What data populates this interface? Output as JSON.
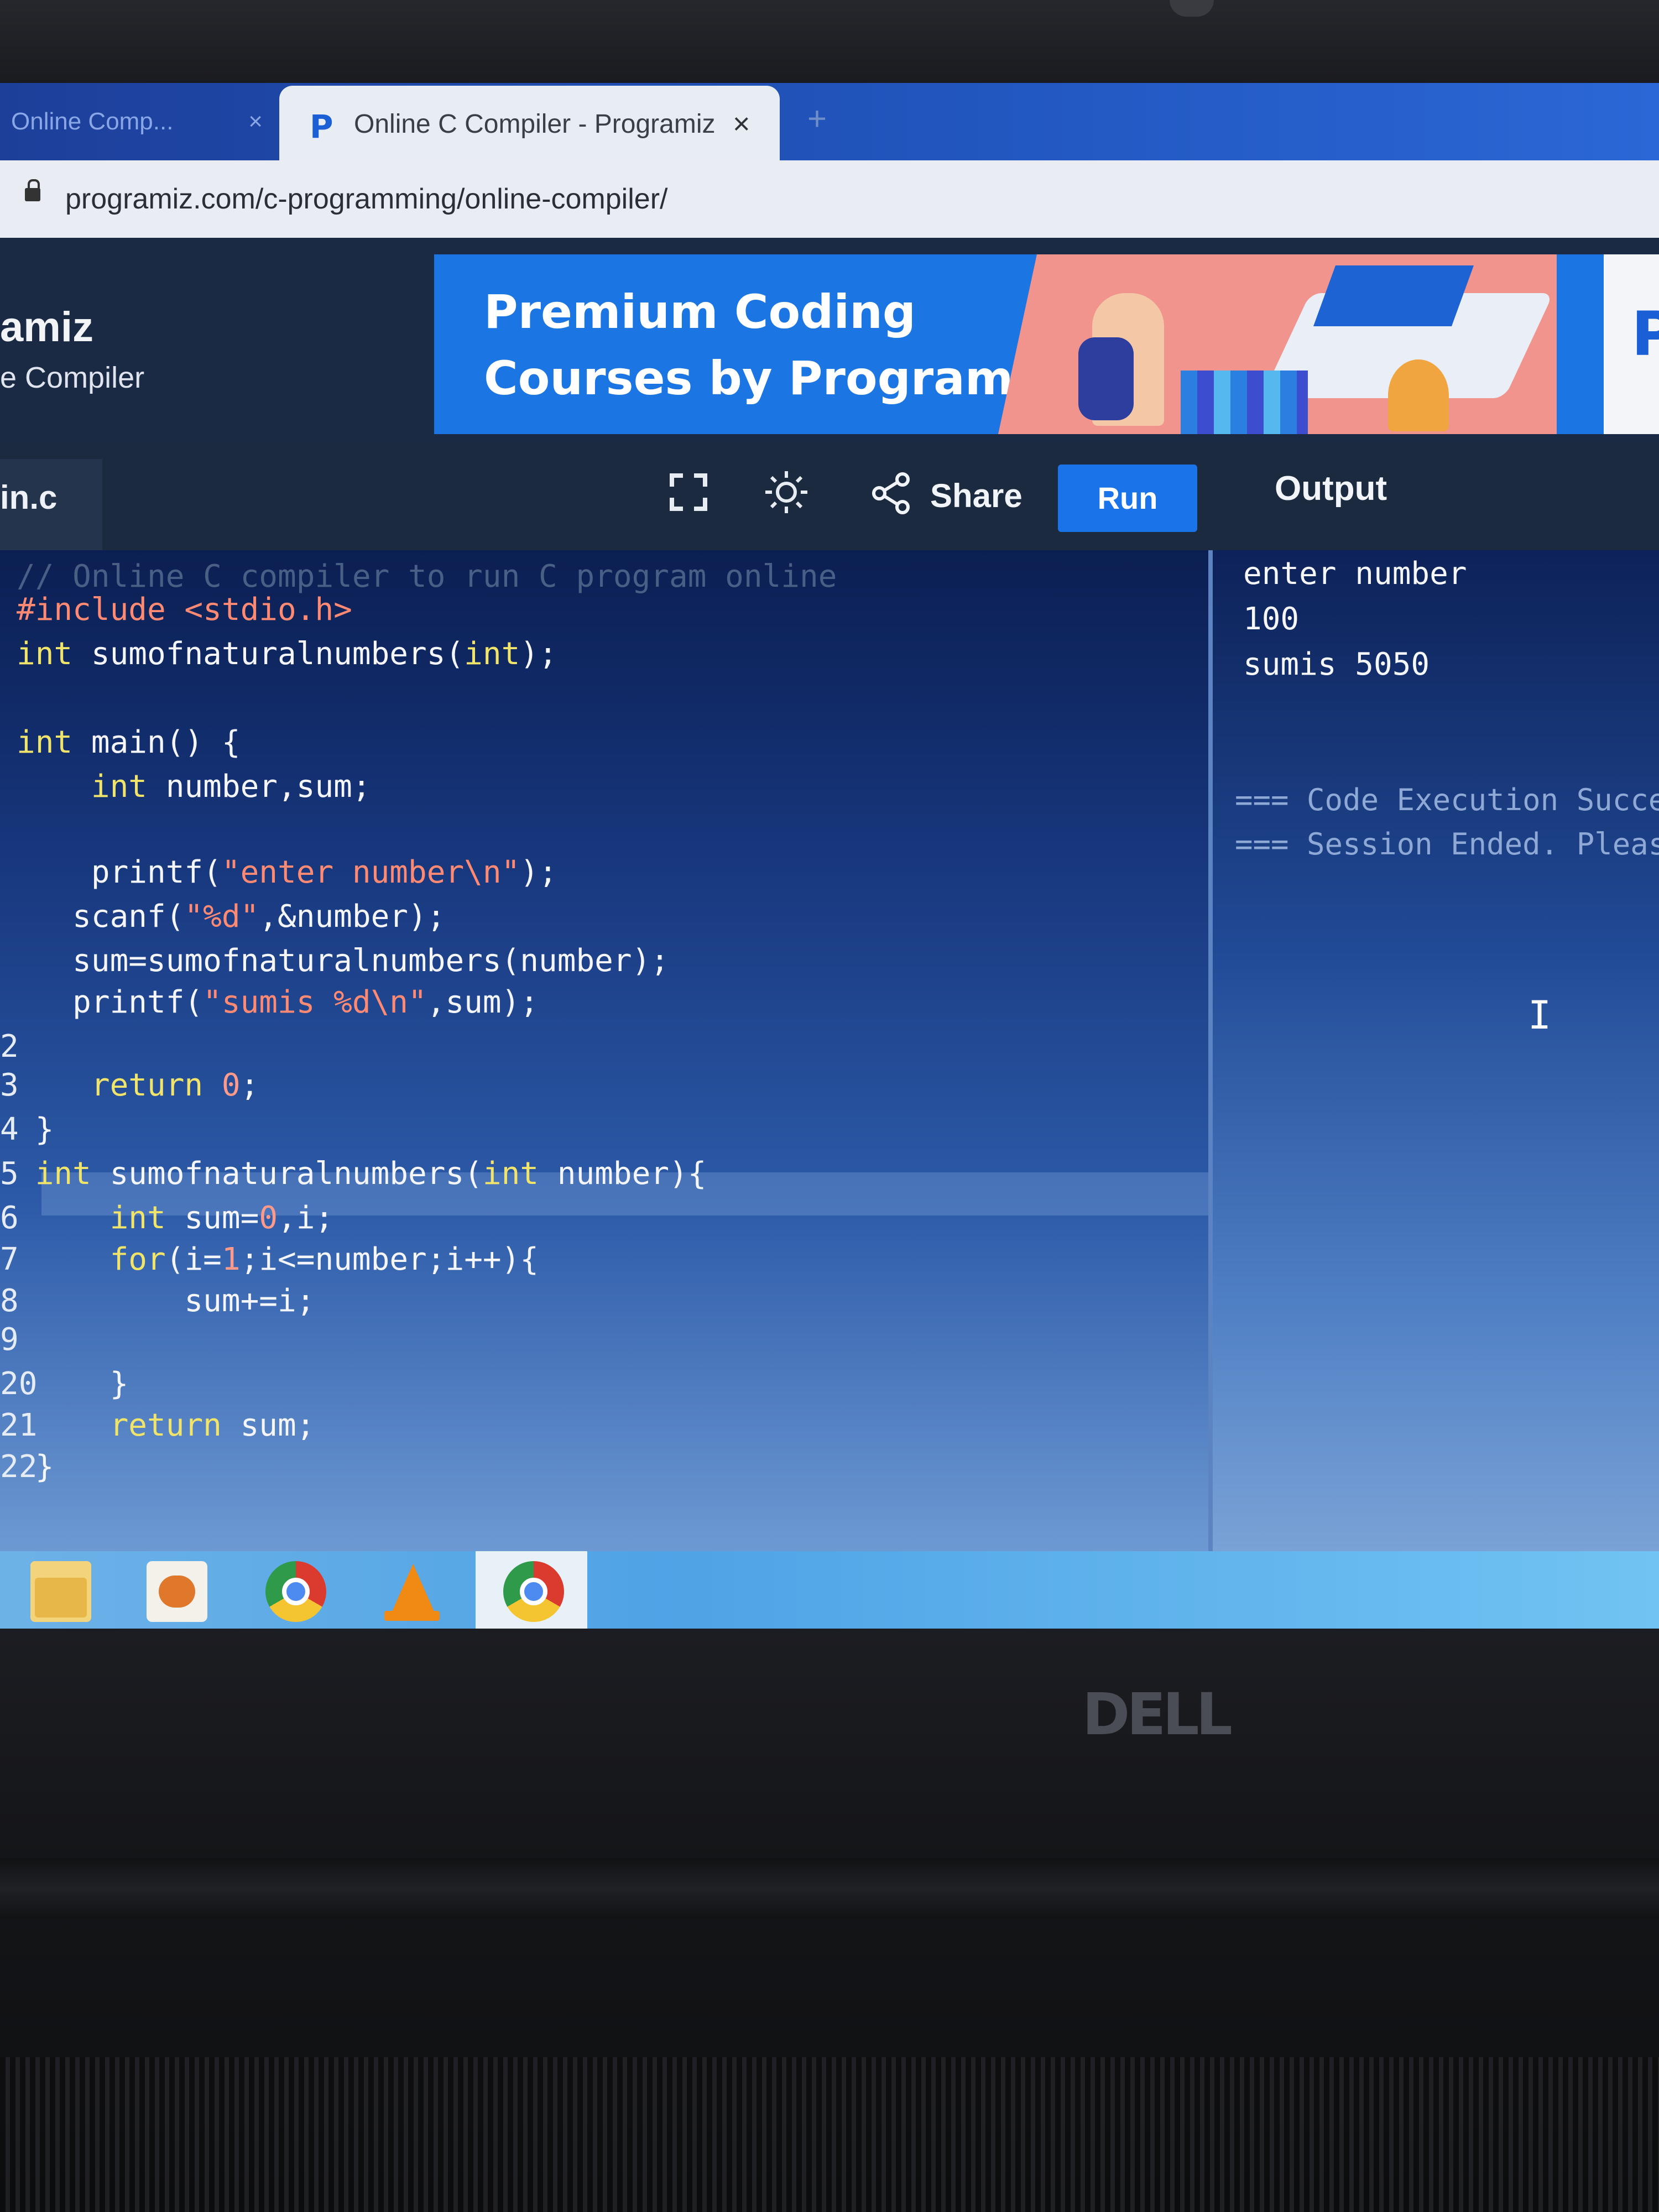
{
  "browser": {
    "inactive_tab_label": "Online Comp...",
    "inactive_tab_close": "×",
    "active_tab_favicon": "P",
    "active_tab_title": "Online C Compiler - Programiz",
    "active_tab_close": "×",
    "new_tab_symbol": "+",
    "url": "programiz.com/c-programming/online-compiler/"
  },
  "header": {
    "brand_name": "amiz",
    "brand_subtitle": "e Compiler",
    "banner_line1": "Premium Coding",
    "banner_line2": "Courses by Programiz",
    "banner_edge_glyph": "P"
  },
  "toolbar": {
    "file_tab": "in.c",
    "share_label": "Share",
    "run_label": "Run",
    "output_label": "Output",
    "expand_icon": "expand-icon",
    "theme_icon": "sun-icon",
    "share_icon": "share-icon"
  },
  "code_lines": [
    {
      "num": "",
      "text": "// Online C compiler to run C program online"
    },
    {
      "num": "",
      "text": "#include <stdio.h>"
    },
    {
      "num": "",
      "text": "int sumofnaturalnumbers(int);"
    },
    {
      "num": "",
      "text": ""
    },
    {
      "num": "",
      "text": "int main() {"
    },
    {
      "num": "",
      "text": "    int number,sum;"
    },
    {
      "num": "",
      "text": ""
    },
    {
      "num": "",
      "text": "    printf(\"enter number\\n\");"
    },
    {
      "num": "",
      "text": "   scanf(\"%d\",&number);"
    },
    {
      "num": "",
      "text": "   sum=sumofnaturalnumbers(number);"
    },
    {
      "num": "",
      "text": "   printf(\"sumis %d\\n\",sum);"
    },
    {
      "num": "2",
      "text": ""
    },
    {
      "num": "3",
      "text": "    return 0;"
    },
    {
      "num": "4",
      "text": " }"
    },
    {
      "num": "5",
      "text": " int sumofnaturalnumbers(int number){"
    },
    {
      "num": "6",
      "text": "     int sum=0,i;"
    },
    {
      "num": "7",
      "text": "     for(i=1;i<=number;i++){"
    },
    {
      "num": "8",
      "text": "         sum+=i;"
    },
    {
      "num": "9",
      "text": ""
    },
    {
      "num": "20",
      "text": "     }"
    },
    {
      "num": "21",
      "text": "     return sum;"
    },
    {
      "num": "22",
      "text": " }"
    }
  ],
  "output": {
    "lines": [
      "enter number",
      "100",
      "sumis 5050"
    ],
    "status_lines": [
      "=== Code Execution Succes",
      "=== Session Ended. Please"
    ],
    "cursor_glyph": "I"
  },
  "laptop": {
    "brand": "DELL"
  },
  "taskbar": {
    "apps": [
      "file-explorer-icon",
      "pictures-icon",
      "chrome-icon",
      "vlc-icon",
      "chrome-profile-icon"
    ]
  }
}
